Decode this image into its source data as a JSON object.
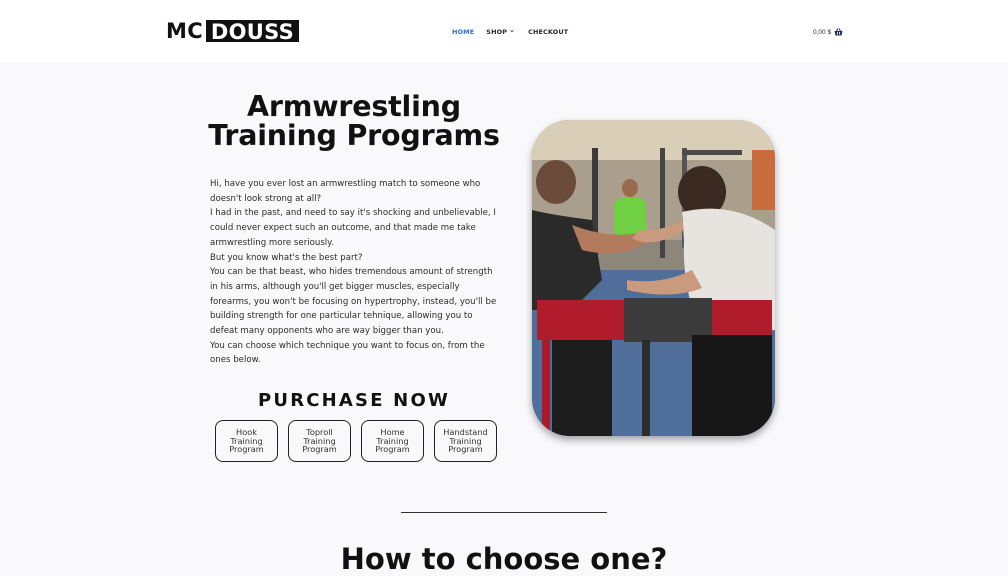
{
  "header": {
    "logo_mc": "MC",
    "logo_douss": "DOUSS",
    "nav": [
      {
        "label": "HOME"
      },
      {
        "label": "SHOP"
      },
      {
        "label": "CHECKOUT"
      }
    ],
    "cart_total": "0,00 $"
  },
  "hero": {
    "title_line1": "Armwrestling",
    "title_line2": "Training Programs",
    "paragraphs": [
      "Hi, have you ever lost an armwrestling match to someone who doesn't look strong at all?",
      "I had in the past, and need to say it's shocking and unbelievable, I could never expect such an outcome, and that made me take armwrestling more seriously.",
      "But you know what's the best part?",
      "You can be that beast, who hides tremendous amount of strength in his arms, although you'll get bigger muscles, especially forearms, you won't be focusing on hypertrophy, instead, you'll be building strength for one particular tehnique, allowing you to defeat many opponents who are way bigger than you.",
      "You can choose which technique you want to focus on, from the ones below."
    ]
  },
  "purchase": {
    "title": "PURCHASE NOW",
    "buttons": [
      {
        "label": "Hook Training Program"
      },
      {
        "label": "Toproll Training Program"
      },
      {
        "label": "Home Training Program"
      },
      {
        "label": "Handstand Training Program"
      }
    ]
  },
  "section2": {
    "title": "How to choose one?"
  },
  "colors": {
    "accent": "#2f6fd6",
    "page_bg": "#f9f9fb",
    "header_bg": "#ffffff"
  },
  "icons": {
    "shop_chevron": "chevron-down-icon",
    "cart": "basket-icon"
  }
}
